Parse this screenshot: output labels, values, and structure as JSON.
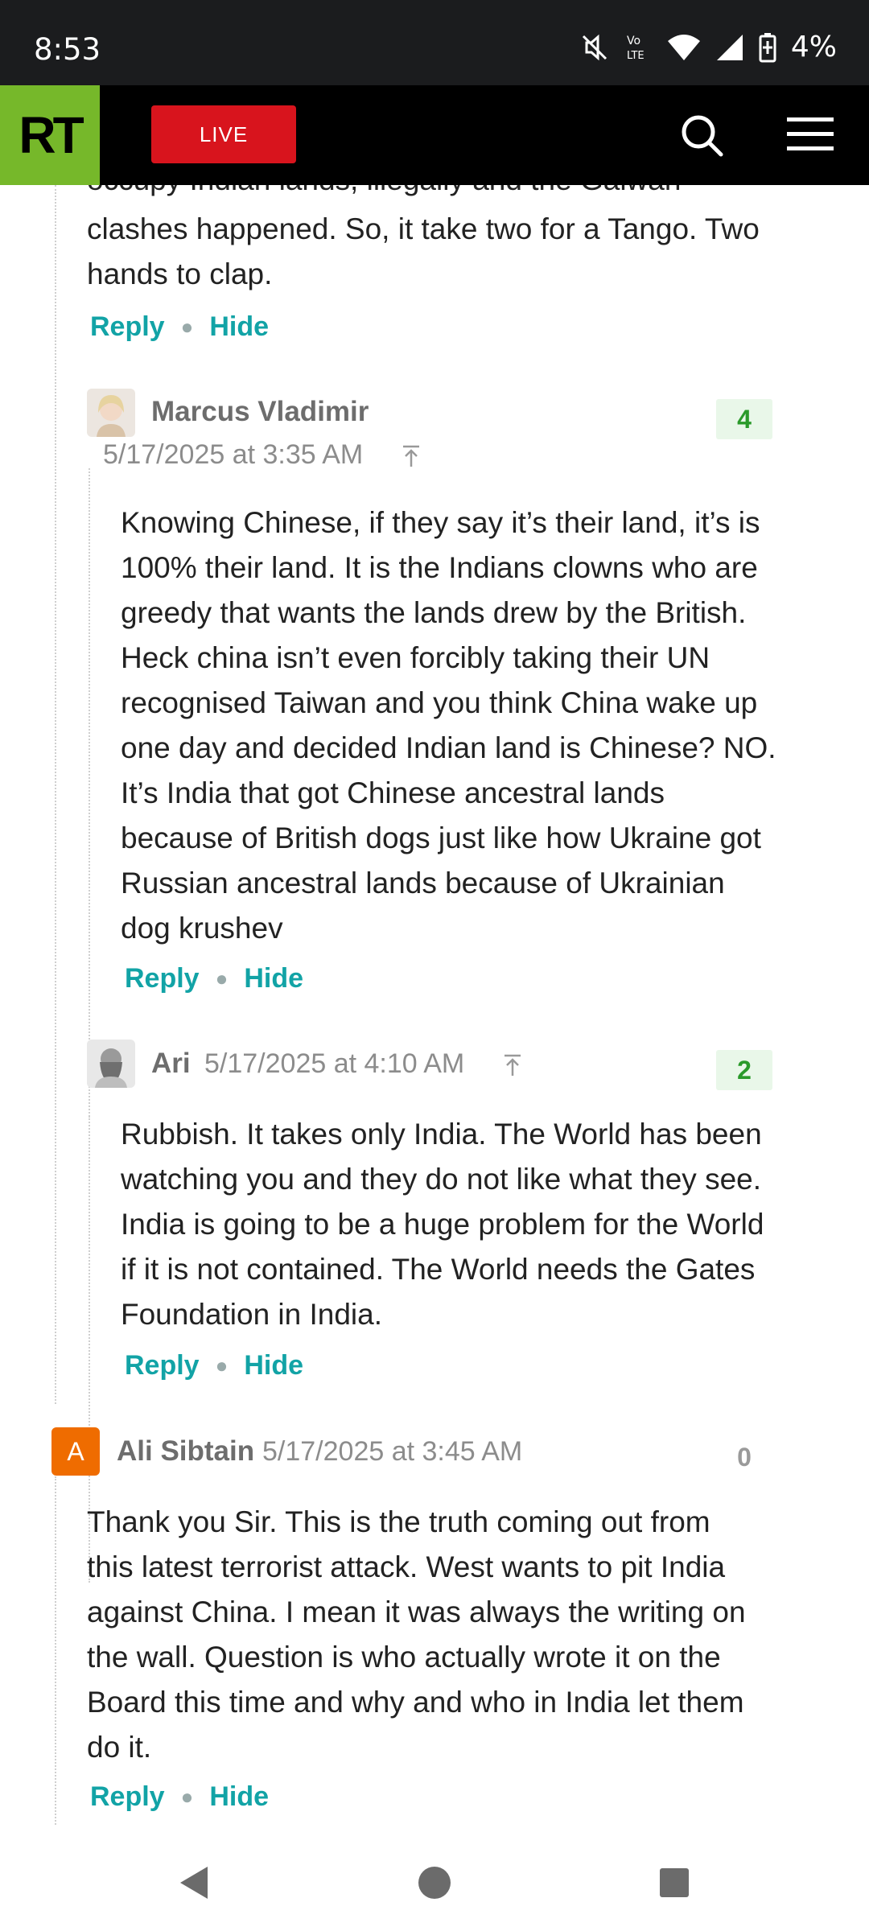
{
  "status_bar": {
    "time": "8:53",
    "battery": "4%",
    "icons": [
      "mute-icon",
      "volte-icon",
      "wifi-icon",
      "signal-icon",
      "battery-icon"
    ]
  },
  "header": {
    "logo": "RT",
    "live_label": "LIVE",
    "icons": [
      "search-icon",
      "menu-icon"
    ],
    "colors": {
      "logo_bg": "#76b82a",
      "live_bg": "#d8141d"
    }
  },
  "comments": {
    "top_partial": {
      "text_cut": "occupy Indian lands, illegally and the Galwan",
      "text_lines": [
        "clashes happened. So, it take two for a Tango. Two",
        "hands to clap."
      ],
      "reply": "Reply",
      "hide": "Hide"
    },
    "marcus": {
      "author": "Marcus Vladimir",
      "date": "5/17/2025 at 3:35 AM",
      "votes": "4",
      "text_lines": [
        "Knowing Chinese, if they say it’s their land, it’s is",
        "100% their land. It is the Indians clowns who are",
        "greedy that wants the lands drew by the British.",
        "Heck china isn’t even forcibly taking their UN",
        "recognised Taiwan and you think China wake up",
        "one day and decided Indian land is Chinese? NO.",
        "It’s India that got Chinese ancestral lands",
        "because of British dogs just like how Ukraine got",
        "Russian ancestral lands because of Ukrainian",
        "dog krushev"
      ],
      "reply": "Reply",
      "hide": "Hide"
    },
    "ari": {
      "author": "Ari",
      "date": "5/17/2025 at 4:10 AM",
      "votes": "2",
      "text_lines": [
        "Rubbish. It takes only India. The World has been",
        "watching you and they do not like what they see.",
        "India is going to be a huge problem for the World",
        "if it is not contained. The World needs the Gates",
        "Foundation in India."
      ],
      "reply": "Reply",
      "hide": "Hide"
    },
    "ali": {
      "avatar_letter": "A",
      "author": "Ali Sibtain",
      "date": "5/17/2025 at 3:45 AM",
      "votes": "0",
      "text_lines": [
        "Thank you Sir. This is the truth coming out from",
        "this latest terrorist attack. West wants to pit India",
        "against China. I mean it was always the writing on",
        "the wall. Question is who actually wrote it on the",
        "Board this time and why and who in India let them",
        "do it."
      ],
      "reply": "Reply",
      "hide": "Hide"
    }
  },
  "nav_bar": {
    "icons": [
      "back-icon",
      "home-icon",
      "recents-icon"
    ]
  }
}
